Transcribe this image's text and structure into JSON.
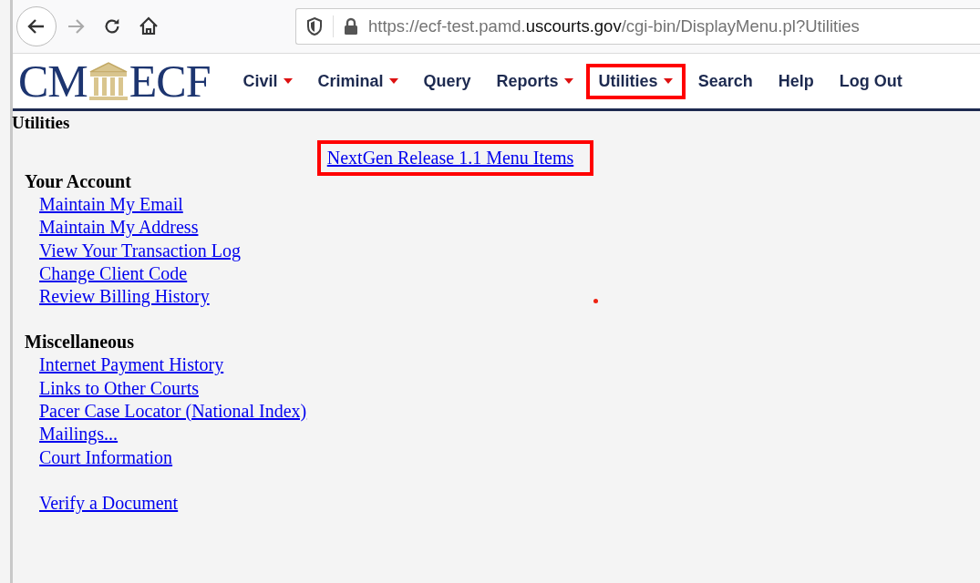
{
  "browser": {
    "url_host_prefix": "https://ecf-test.pamd.",
    "url_host_domain": "uscourts.gov",
    "url_path": "/cgi-bin/DisplayMenu.pl?Utilities"
  },
  "logo": {
    "left": "CM",
    "right": "ECF"
  },
  "menu": [
    {
      "label": "Civil",
      "dropdown": true,
      "highlighted": false
    },
    {
      "label": "Criminal",
      "dropdown": true,
      "highlighted": false
    },
    {
      "label": "Query",
      "dropdown": false,
      "highlighted": false
    },
    {
      "label": "Reports",
      "dropdown": true,
      "highlighted": false
    },
    {
      "label": "Utilities",
      "dropdown": true,
      "highlighted": true
    },
    {
      "label": "Search",
      "dropdown": false,
      "highlighted": false
    },
    {
      "label": "Help",
      "dropdown": false,
      "highlighted": false
    },
    {
      "label": "Log Out",
      "dropdown": false,
      "highlighted": false
    }
  ],
  "page_title": "Utilities",
  "featured_link": {
    "label": "NextGen Release 1.1 Menu Items",
    "highlighted": true
  },
  "sections": [
    {
      "heading": "Your Account",
      "links": [
        "Maintain My Email",
        "Maintain My Address",
        "View Your Transaction Log",
        "Change Client Code",
        "Review Billing History"
      ]
    },
    {
      "heading": "Miscellaneous",
      "links": [
        "Internet Payment History",
        "Links to Other Courts",
        "Pacer Case Locator (National Index)",
        "Mailings...",
        "Court Information"
      ]
    },
    {
      "links": [
        "Verify a Document"
      ]
    }
  ]
}
